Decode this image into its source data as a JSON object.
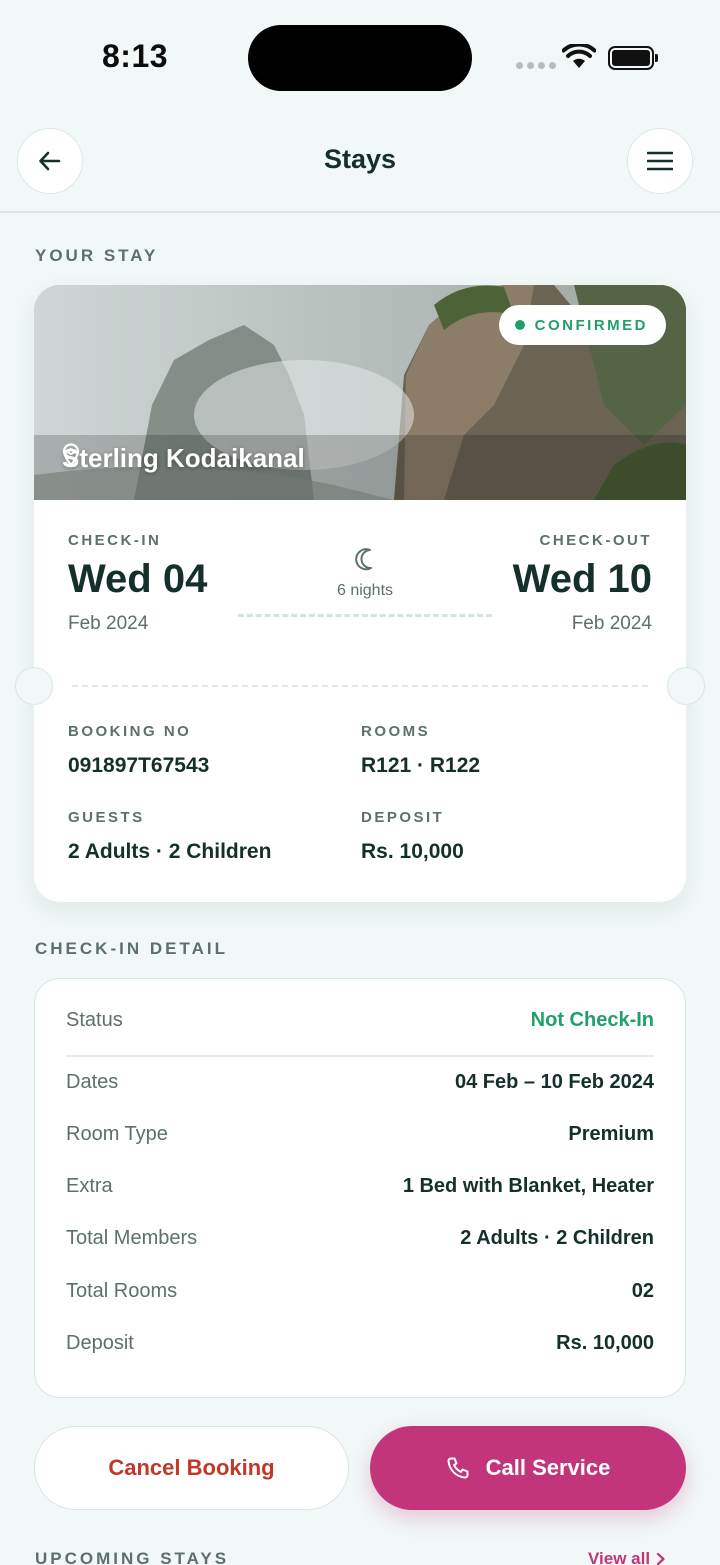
{
  "status_bar": {
    "time": "8:13"
  },
  "header": {
    "title": "Stays"
  },
  "sections": {
    "your_stay": "YOUR STAY",
    "checkin_detail": "CHECK-IN DETAIL",
    "upcoming": "UPCOMING STAYS"
  },
  "stay": {
    "status_badge": "CONFIRMED",
    "hotel_name": "Sterling Kodaikanal",
    "check_in": {
      "label": "CHECK-IN",
      "day": "Wed 04",
      "month": "Feb 2024"
    },
    "check_out": {
      "label": "CHECK-OUT",
      "day": "Wed 10",
      "month": "Feb 2024"
    },
    "nights": "6 nights",
    "booking_no": {
      "label": "BOOKING NO",
      "value": "091897T67543"
    },
    "rooms": {
      "label": "ROOMS",
      "value": "R121 · R122"
    },
    "guests": {
      "label": "GUESTS",
      "value": "2 Adults · 2 Children"
    },
    "deposit": {
      "label": "DEPOSIT",
      "value": "Rs. 10,000"
    }
  },
  "detail": {
    "rows": [
      {
        "key": "Status",
        "value": "Not Check-In"
      },
      {
        "key": "Dates",
        "value": "04 Feb – 10 Feb 2024"
      },
      {
        "key": "Room Type",
        "value": "Premium"
      },
      {
        "key": "Extra",
        "value": "1 Bed with Blanket, Heater"
      },
      {
        "key": "Total Members",
        "value": "2 Adults · 2 Children"
      },
      {
        "key": "Total Rooms",
        "value": "02"
      },
      {
        "key": "Deposit",
        "value": "Rs. 10,000"
      }
    ]
  },
  "actions": {
    "cancel": "Cancel Booking",
    "call": "Call Service"
  },
  "upcoming": {
    "view_all": "View all"
  },
  "colors": {
    "accent": "#c2357b",
    "success": "#22a06b",
    "danger": "#c0392b",
    "background": "#f1f8f7"
  },
  "icons": [
    "back-arrow-icon",
    "menu-icon",
    "map-pin-icon",
    "moon-icon",
    "phone-icon",
    "chevron-right-icon",
    "wifi-icon",
    "battery-icon"
  ]
}
